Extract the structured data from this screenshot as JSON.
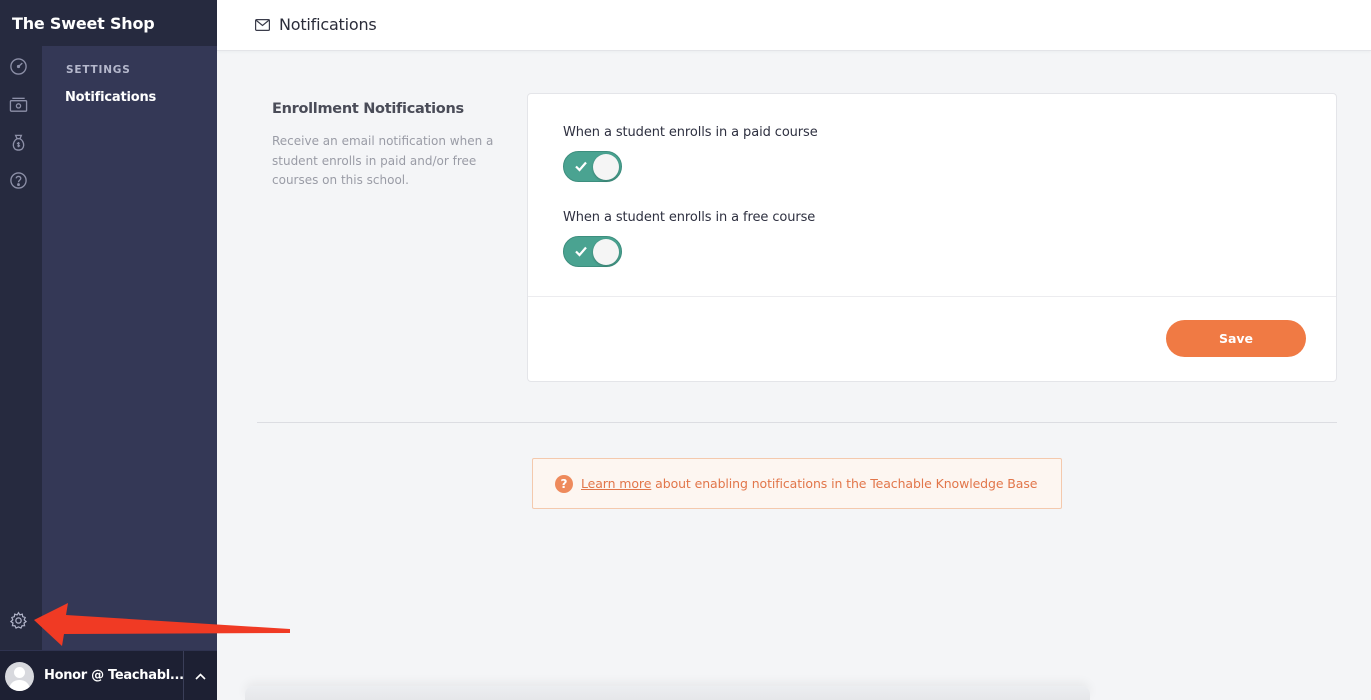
{
  "brand": {
    "name": "The Sweet Shop"
  },
  "subnav": {
    "heading": "SETTINGS",
    "active_item": "Notifications"
  },
  "rail": {
    "icons": [
      "dashboard-icon",
      "sales-icon",
      "money-bag-icon",
      "help-icon",
      "settings-gear-icon"
    ]
  },
  "user": {
    "name": "Honor @ Teachabl...",
    "toggle_icon": "chevron-up-icon"
  },
  "header": {
    "title": "Notifications",
    "icon": "envelope-icon"
  },
  "section": {
    "title": "Enrollment Notifications",
    "description": "Receive an email notification when a student enrolls in paid and/or free courses on this school."
  },
  "options": [
    {
      "label": "When a student enrolls in a paid course",
      "enabled": true
    },
    {
      "label": "When a student enrolls in a free course",
      "enabled": true
    }
  ],
  "actions": {
    "save_label": "Save"
  },
  "help": {
    "icon_glyph": "?",
    "link_text": "Learn more",
    "rest_text": " about enabling notifications in the Teachable Knowledge Base"
  },
  "colors": {
    "sidebar_dark": "#262a3f",
    "sidebar_sub": "#343856",
    "toggle_on": "#4aa391",
    "accent_orange": "#f07a44",
    "annotation_red": "#f03a24"
  }
}
